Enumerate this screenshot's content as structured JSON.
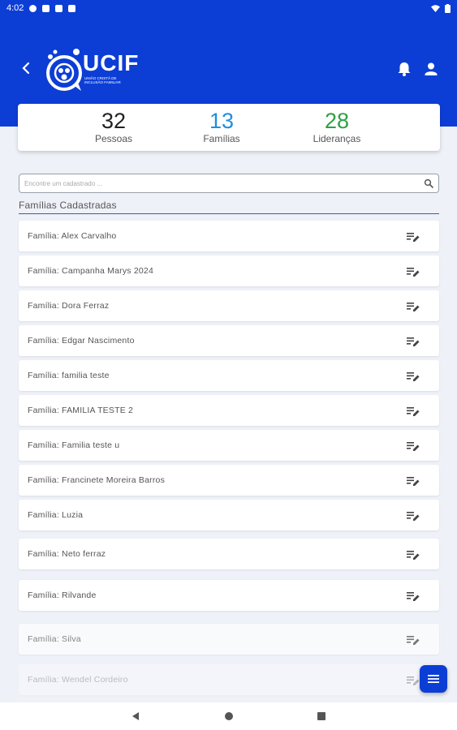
{
  "status_bar": {
    "time": "4:02"
  },
  "header": {
    "logo_text": "UCIF",
    "logo_subtitle": "UNIÃO CRISTÃ DE INCLUSÃO FAMILIAR"
  },
  "stats": [
    {
      "value": "32",
      "label": "Pessoas",
      "color": "#222222"
    },
    {
      "value": "13",
      "label": "Famílias",
      "color": "#1f8fe0"
    },
    {
      "value": "28",
      "label": "Lideranças",
      "color": "#2ea043"
    }
  ],
  "search": {
    "placeholder": "Encontre um cadastrado ..."
  },
  "section_title": "Famílias Cadastradas",
  "families": [
    "Família: Alex Carvalho",
    "Família: Campanha Marys 2024",
    "Família: Dora Ferraz",
    "Família: Edgar Nascimento",
    "Família: familia teste",
    "Família: FAMILIA TESTE 2",
    "Família: Familia teste u",
    "Família: Francinete Moreira Barros",
    "Família: Luzia",
    "Família: Neto ferraz",
    "Família: Rilvande",
    "Família: Silva",
    "Família: Wendel Cordeiro"
  ],
  "icons": {
    "back": "arrow-back-icon",
    "bell": "bell-icon",
    "user": "user-icon",
    "search": "search-icon",
    "edit": "edit-note-icon",
    "menu": "menu-icon"
  },
  "colors": {
    "brand": "#0c3ed6",
    "background": "#eef1f8"
  }
}
